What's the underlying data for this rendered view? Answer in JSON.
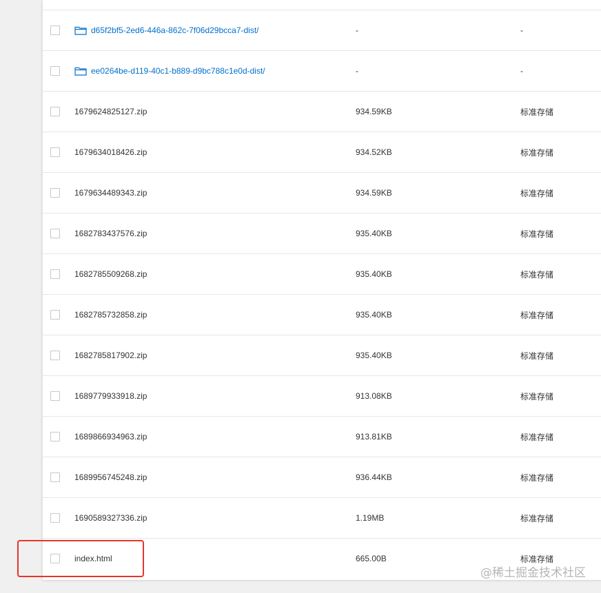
{
  "files": [
    {
      "name": "d65f2bf5-2ed6-446a-862c-7f06d29bcca7-dist/",
      "size": "-",
      "storage": "-",
      "is_folder": true
    },
    {
      "name": "ee0264be-d119-40c1-b889-d9bc788c1e0d-dist/",
      "size": "-",
      "storage": "-",
      "is_folder": true
    },
    {
      "name": "1679624825127.zip",
      "size": "934.59KB",
      "storage": "标准存储",
      "is_folder": false
    },
    {
      "name": "1679634018426.zip",
      "size": "934.52KB",
      "storage": "标准存储",
      "is_folder": false
    },
    {
      "name": "1679634489343.zip",
      "size": "934.59KB",
      "storage": "标准存储",
      "is_folder": false
    },
    {
      "name": "1682783437576.zip",
      "size": "935.40KB",
      "storage": "标准存储",
      "is_folder": false
    },
    {
      "name": "1682785509268.zip",
      "size": "935.40KB",
      "storage": "标准存储",
      "is_folder": false
    },
    {
      "name": "1682785732858.zip",
      "size": "935.40KB",
      "storage": "标准存储",
      "is_folder": false
    },
    {
      "name": "1682785817902.zip",
      "size": "935.40KB",
      "storage": "标准存储",
      "is_folder": false
    },
    {
      "name": "1689779933918.zip",
      "size": "913.08KB",
      "storage": "标准存储",
      "is_folder": false
    },
    {
      "name": "1689866934963.zip",
      "size": "913.81KB",
      "storage": "标准存储",
      "is_folder": false
    },
    {
      "name": "1689956745248.zip",
      "size": "936.44KB",
      "storage": "标准存储",
      "is_folder": false
    },
    {
      "name": "1690589327336.zip",
      "size": "1.19MB",
      "storage": "标准存储",
      "is_folder": false
    },
    {
      "name": "index.html",
      "size": "665.00B",
      "storage": "标准存储",
      "is_folder": false
    }
  ],
  "watermark": "@稀土掘金技术社区",
  "colors": {
    "folder_link": "#0070cc",
    "highlight_box": "#e8332a",
    "text": "#333333",
    "background": "#f0f0f0"
  }
}
